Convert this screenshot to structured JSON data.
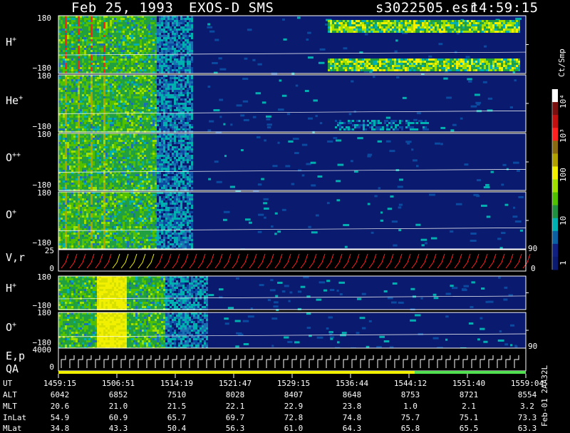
{
  "header": {
    "date": "Feb 25, 1993",
    "instrument": "EXOS-D SMS",
    "file": "s3022505.esr",
    "time": "14:59:15"
  },
  "panels": [
    {
      "label": "H",
      "sup": "+",
      "top_tick": "180",
      "bottom_tick": "−180"
    },
    {
      "label": "He",
      "sup": "+",
      "top_tick": "180",
      "bottom_tick": "−180"
    },
    {
      "label": "O",
      "sup": "++",
      "top_tick": "180",
      "bottom_tick": "−180"
    },
    {
      "label": "O",
      "sup": "+",
      "top_tick": "180",
      "bottom_tick": "−180"
    },
    {
      "label": "V,r",
      "sup": "",
      "top_tick": "25",
      "bottom_tick": "0",
      "right_top": "90",
      "right_bottom": "0"
    },
    {
      "label": "H",
      "sup": "+",
      "top_tick": "180",
      "bottom_tick": "−180"
    },
    {
      "label": "O",
      "sup": "+",
      "top_tick": "180",
      "bottom_tick": "−180"
    },
    {
      "label": "E,p",
      "label2": "QA",
      "top_tick": "4000",
      "bottom_tick": "0",
      "right_top": "90"
    }
  ],
  "colorbar": {
    "unit": "Ct/Smp",
    "ticks": [
      "10⁴",
      "10³",
      "100",
      "10",
      "1"
    ],
    "colors": [
      "#ffffff",
      "#7a1010",
      "#c01010",
      "#ff2020",
      "#8a6a10",
      "#b0a000",
      "#f0f000",
      "#a0e000",
      "#50c000",
      "#209040",
      "#00b0b0",
      "#0a60a0",
      "#102080",
      "#0a1a6e"
    ]
  },
  "table": {
    "rows": [
      {
        "name": "UT",
        "values": [
          "1459:15",
          "1506:51",
          "1514:19",
          "1521:47",
          "1529:15",
          "1536:44",
          "1544:12",
          "1551:40",
          "1559:04"
        ]
      },
      {
        "name": "ALT",
        "values": [
          "6042",
          "6852",
          "7510",
          "8028",
          "8407",
          "8648",
          "8753",
          "8721",
          "8554"
        ]
      },
      {
        "name": "MLT",
        "values": [
          "20.6",
          "21.0",
          "21.5",
          "22.1",
          "22.9",
          "23.8",
          "1.0",
          "2.1",
          "3.2"
        ]
      },
      {
        "name": "InLat",
        "values": [
          "54.9",
          "60.9",
          "65.7",
          "69.7",
          "72.8",
          "74.8",
          "75.7",
          "75.1",
          "73.3"
        ]
      },
      {
        "name": "MLat",
        "values": [
          "34.8",
          "43.3",
          "50.4",
          "56.3",
          "61.0",
          "64.3",
          "65.8",
          "65.5",
          "63.3"
        ]
      }
    ]
  },
  "footer_right": "Feb-01 2AA32L",
  "chart_data": {
    "type": "heatmap",
    "title": "Feb 25, 1993   EXOS-D SMS",
    "x_ticks": [
      "1459:15",
      "1506:51",
      "1514:19",
      "1521:47",
      "1529:15",
      "1536:44",
      "1544:12",
      "1551:40",
      "1559:04"
    ],
    "series": [
      {
        "name": "H+",
        "ylim": [
          -180,
          180
        ]
      },
      {
        "name": "He+",
        "ylim": [
          -180,
          180
        ]
      },
      {
        "name": "O++",
        "ylim": [
          -180,
          180
        ]
      },
      {
        "name": "O+",
        "ylim": [
          -180,
          180
        ]
      },
      {
        "name": "V,r",
        "ylim": [
          0,
          25
        ]
      },
      {
        "name": "H+",
        "ylim": [
          -180,
          180
        ]
      },
      {
        "name": "O+",
        "ylim": [
          -180,
          180
        ]
      },
      {
        "name": "E,p",
        "ylim": [
          0,
          4000
        ]
      }
    ],
    "colorbar_unit": "Ct/Smp",
    "colorbar_range": [
      "1",
      "10⁴"
    ]
  }
}
